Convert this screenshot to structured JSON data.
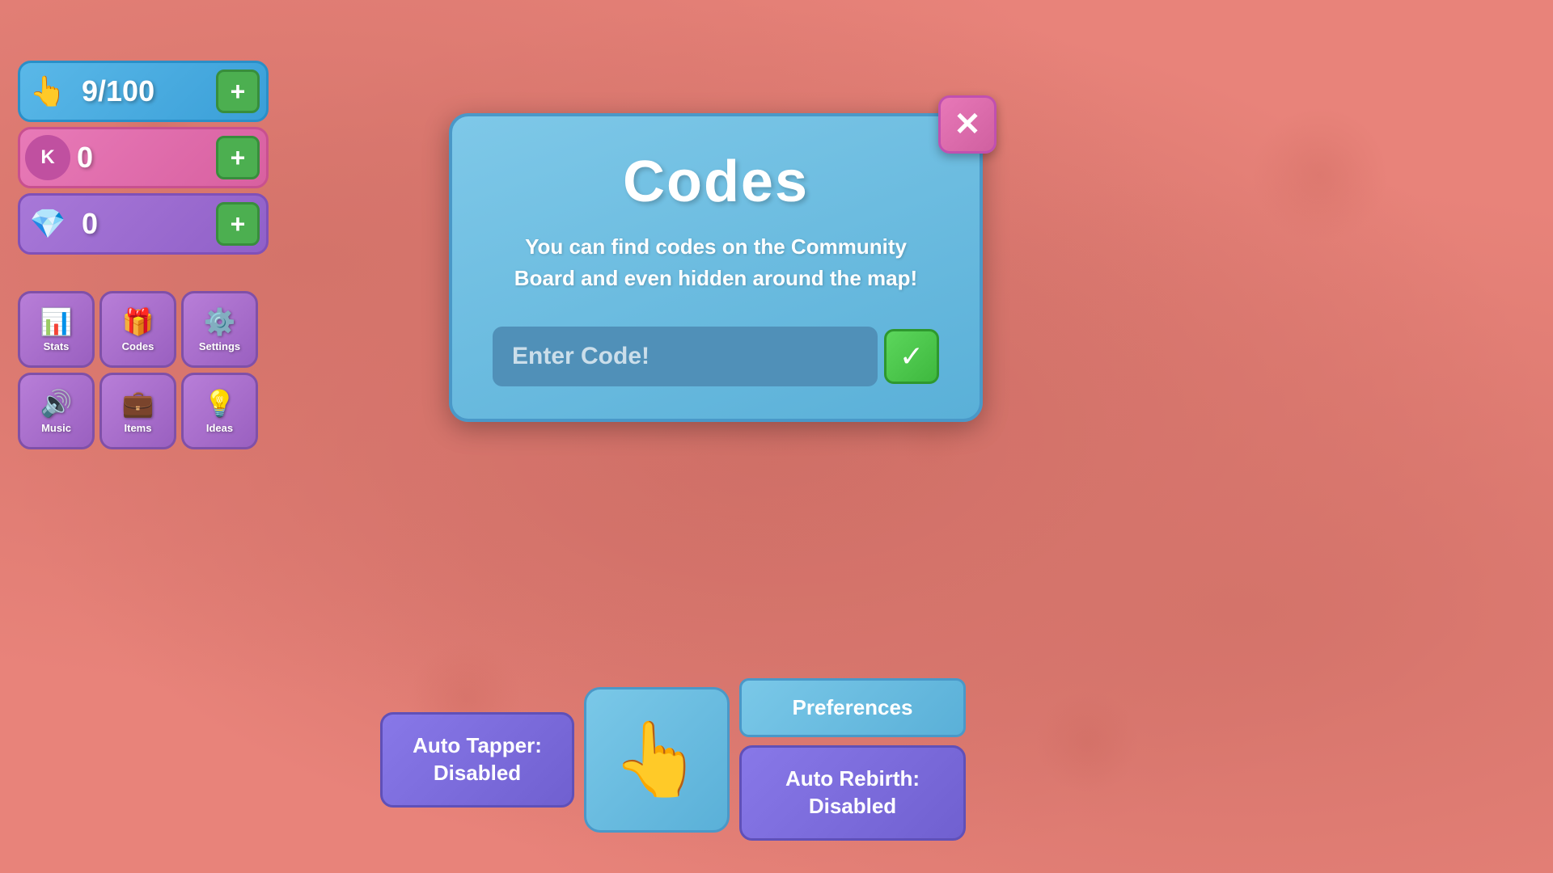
{
  "currency": {
    "clicks": {
      "value": "9/100",
      "plus_label": "+"
    },
    "coins": {
      "value": "0",
      "plus_label": "+"
    },
    "gems": {
      "value": "0",
      "plus_label": "+"
    }
  },
  "nav_buttons": [
    {
      "id": "stats",
      "label": "Stats",
      "icon": "📊"
    },
    {
      "id": "codes",
      "label": "Codes",
      "icon": "🎁"
    },
    {
      "id": "settings",
      "label": "Settings",
      "icon": "⚙️"
    },
    {
      "id": "music",
      "label": "Music",
      "icon": "🔊"
    },
    {
      "id": "items",
      "label": "Items",
      "icon": "💼"
    },
    {
      "id": "ideas",
      "label": "Ideas",
      "icon": "💡"
    }
  ],
  "modal": {
    "title": "Codes",
    "description": "You can find codes on the Community Board and even hidden around the map!",
    "input_placeholder": "Enter Code!",
    "submit_icon": "✓"
  },
  "close_button": {
    "label": "✕"
  },
  "bottom": {
    "auto_tapper": "Auto Tapper:\nDisabled",
    "preferences": "Preferences",
    "auto_rebirth": "Auto Rebirth:\nDisabled"
  }
}
